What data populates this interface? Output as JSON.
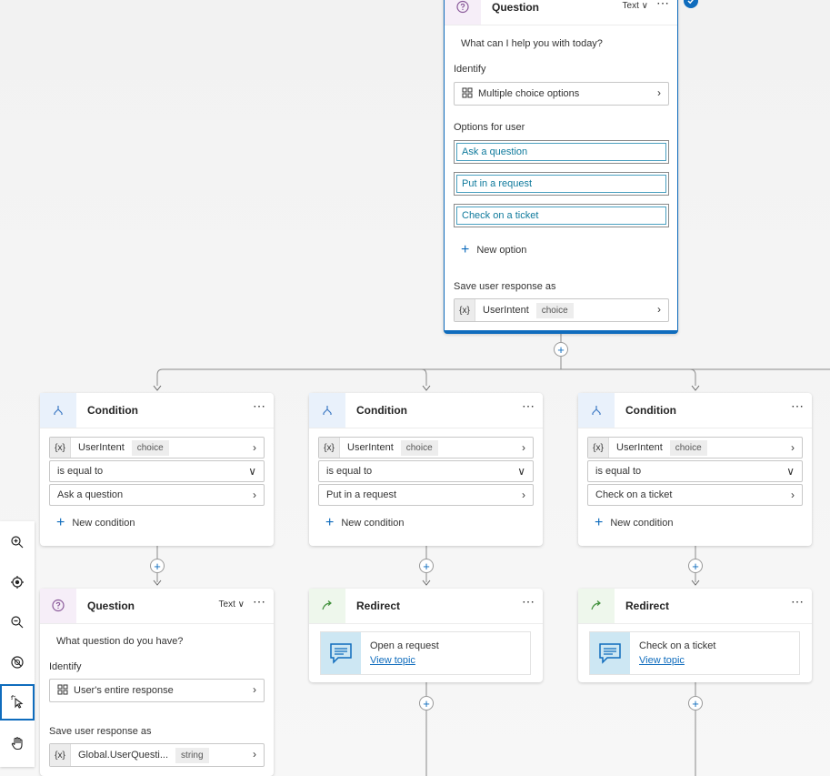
{
  "top_question": {
    "title": "Question",
    "format": "Text",
    "message": "What can I help you with today?",
    "identify_label": "Identify",
    "identify_value": "Multiple choice options",
    "options_label": "Options for user",
    "options": [
      "Ask a question",
      "Put in a request",
      "Check on a ticket"
    ],
    "new_option": "New option",
    "save_label": "Save user response as",
    "variable": {
      "x": "{x}",
      "name": "UserIntent",
      "type": "choice"
    }
  },
  "conditions": [
    {
      "title": "Condition",
      "var_x": "{x}",
      "var_name": "UserIntent",
      "var_type": "choice",
      "operator": "is equal to",
      "value": "Ask a question",
      "new_condition": "New condition"
    },
    {
      "title": "Condition",
      "var_x": "{x}",
      "var_name": "UserIntent",
      "var_type": "choice",
      "operator": "is equal to",
      "value": "Put in a request",
      "new_condition": "New condition"
    },
    {
      "title": "Condition",
      "var_x": "{x}",
      "var_name": "UserIntent",
      "var_type": "choice",
      "operator": "is equal to",
      "value": "Check on a ticket",
      "new_condition": "New condition"
    }
  ],
  "bottom_question": {
    "title": "Question",
    "format": "Text",
    "message": "What question do you have?",
    "identify_label": "Identify",
    "identify_value": "User's entire response",
    "save_label": "Save user response as",
    "variable": {
      "x": "{x}",
      "name": "Global.UserQuesti...",
      "type": "string"
    }
  },
  "redirects": [
    {
      "title": "Redirect",
      "topic": "Open a request",
      "link": "View topic"
    },
    {
      "title": "Redirect",
      "topic": "Check on a ticket",
      "link": "View topic"
    }
  ],
  "toolbar": [
    "zoom-in-icon",
    "focus-icon",
    "zoom-out-icon",
    "minimap-off-icon",
    "select-pointer-icon",
    "pan-hand-icon"
  ],
  "colors": {
    "accent": "#0f6cbd",
    "option_text": "#0f7a9c",
    "connector": "#8a8a8a"
  }
}
